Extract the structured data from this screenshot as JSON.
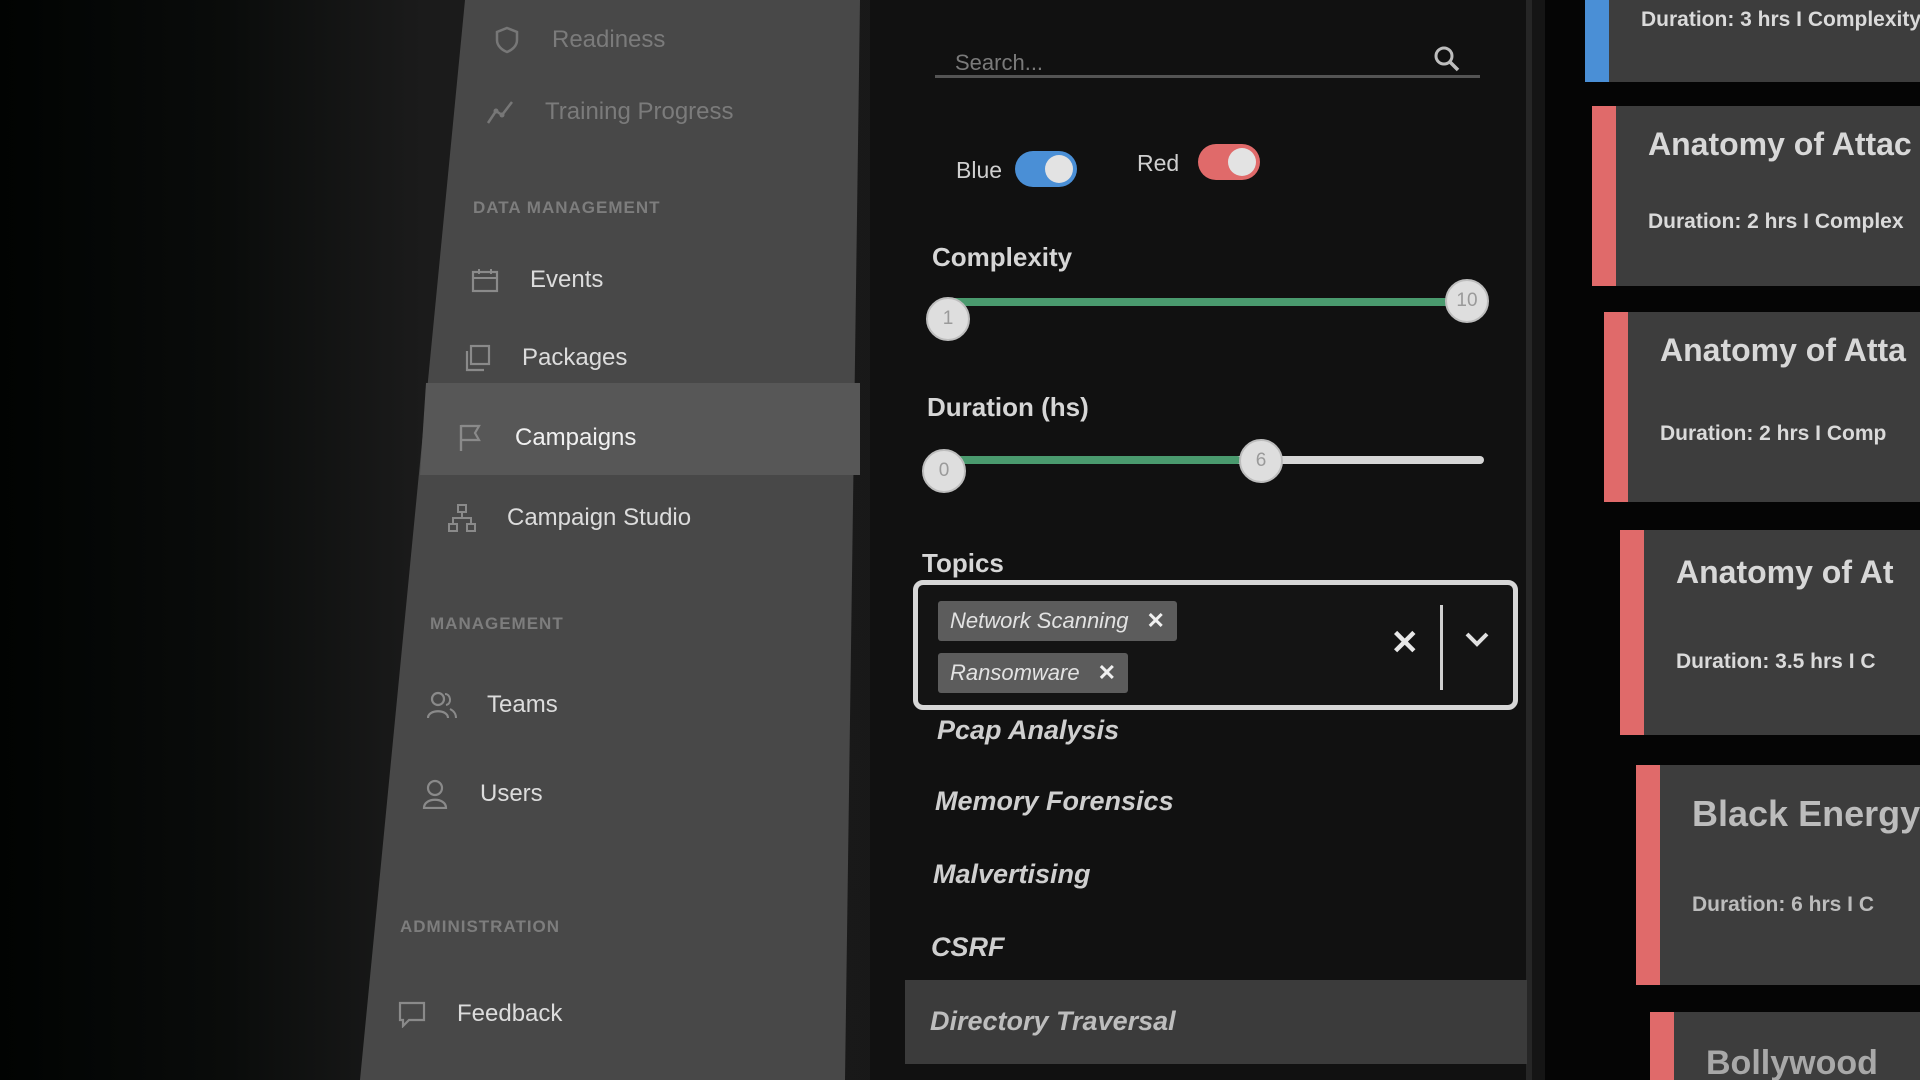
{
  "sidebar": {
    "top_items": [
      {
        "label": "Readiness",
        "icon": "shield-icon"
      },
      {
        "label": "Training Progress",
        "icon": "trend-icon"
      }
    ],
    "sections": [
      {
        "title": "DATA MANAGEMENT",
        "items": [
          {
            "label": "Events",
            "icon": "calendar-icon"
          },
          {
            "label": "Packages",
            "icon": "packages-icon"
          },
          {
            "label": "Campaigns",
            "icon": "flag-icon",
            "active": true
          },
          {
            "label": "Campaign Studio",
            "icon": "hierarchy-icon"
          }
        ]
      },
      {
        "title": "MANAGEMENT",
        "items": [
          {
            "label": "Teams",
            "icon": "team-icon"
          },
          {
            "label": "Users",
            "icon": "user-icon"
          }
        ]
      },
      {
        "title": "ADMINISTRATION",
        "items": [
          {
            "label": "Feedback",
            "icon": "feedback-icon"
          }
        ]
      }
    ]
  },
  "filters": {
    "search": {
      "placeholder": "Search..."
    },
    "toggles": [
      {
        "label": "Blue",
        "on": true,
        "color": "#4a8fd6"
      },
      {
        "label": "Red",
        "on": true,
        "color": "#e06a6a"
      }
    ],
    "complexity": {
      "title": "Complexity",
      "min": 1,
      "max": 10,
      "low": 1,
      "high": 10
    },
    "duration": {
      "title": "Duration (hs)",
      "min": 0,
      "low": 0,
      "high": 6,
      "fill_fraction": 0.55
    },
    "topics": {
      "title": "Topics",
      "selected": [
        "Network Scanning",
        "Ransomware"
      ],
      "options": [
        "Pcap Analysis",
        "Memory Forensics",
        "Malvertising",
        "CSRF",
        "Directory Traversal"
      ],
      "highlighted": "Directory Traversal"
    }
  },
  "cards": [
    {
      "title": "",
      "meta": "Duration: 3 hrs I Complexity",
      "color": "#4a8fd6"
    },
    {
      "title": "Anatomy of Attac",
      "meta": "Duration: 2 hrs I Complex",
      "color": "#e06a6a"
    },
    {
      "title": "Anatomy of Atta",
      "meta": "Duration: 2 hrs I Comp",
      "color": "#e06a6a"
    },
    {
      "title": "Anatomy of At",
      "meta": "Duration: 3.5 hrs I C",
      "color": "#e06a6a"
    },
    {
      "title": "Black Energy",
      "meta": "Duration: 6 hrs I C",
      "color": "#e06a6a"
    },
    {
      "title": "Bollywood",
      "meta": "",
      "color": "#e06a6a"
    }
  ]
}
